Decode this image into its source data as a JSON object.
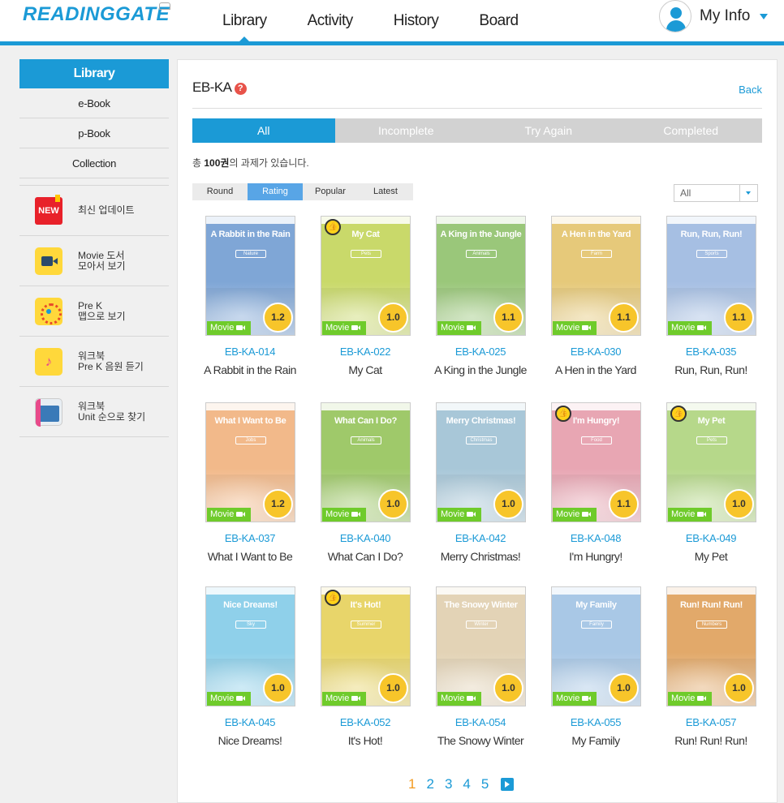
{
  "brand": {
    "logo_text": "READINGGATE"
  },
  "nav": {
    "items": [
      "Library",
      "Activity",
      "History",
      "Board"
    ],
    "active": "Library"
  },
  "user": {
    "label": "My Info"
  },
  "sidebar": {
    "title": "Library",
    "links": [
      "e-Book",
      "p-Book",
      "Collection"
    ],
    "features": [
      {
        "icon": "new-badge-icon",
        "badge": "NEW",
        "label": "최신 업데이트"
      },
      {
        "icon": "movie-camera-icon",
        "label": "Movie 도서\n모아서 보기"
      },
      {
        "icon": "pre-k-map-icon",
        "label": "Pre K\n맵으로 보기"
      },
      {
        "icon": "music-note-icon",
        "label": "워크북\nPre K 음원 듣기"
      },
      {
        "icon": "workbook-icon",
        "label": "워크북\nUnit 순으로 찾기"
      }
    ]
  },
  "main": {
    "title": "EB-KA",
    "help_symbol": "?",
    "back_label": "Back",
    "status_tabs": [
      "All",
      "Incomplete",
      "Try Again",
      "Completed"
    ],
    "count_prefix": "총 ",
    "count_value": "100권",
    "count_suffix": "의 과제가 있습니다.",
    "sort_tabs": [
      "Round",
      "Rating",
      "Popular",
      "Latest"
    ],
    "filter_value": "All",
    "movie_label": "Movie",
    "books": [
      {
        "code": "EB-KA-014",
        "title": "A Rabbit in the Rain",
        "cover_title": "A Rabbit in the Rain",
        "theme": "Nature",
        "level": "1.2",
        "recommended": false,
        "color": "#7fa6d6"
      },
      {
        "code": "EB-KA-022",
        "title": "My Cat",
        "cover_title": "My Cat",
        "theme": "Pets",
        "level": "1.0",
        "recommended": true,
        "color": "#c9d96a"
      },
      {
        "code": "EB-KA-025",
        "title": "A King in the Jungle",
        "cover_title": "A King in the Jungle",
        "theme": "Animals",
        "level": "1.1",
        "recommended": false,
        "color": "#9ac77a"
      },
      {
        "code": "EB-KA-030",
        "title": "A Hen in the Yard",
        "cover_title": "A Hen in the Yard",
        "theme": "Farm",
        "level": "1.1",
        "recommended": false,
        "color": "#e6c97a"
      },
      {
        "code": "EB-KA-035",
        "title": "Run, Run, Run!",
        "cover_title": "Run, Run, Run!",
        "theme": "Sports",
        "level": "1.1",
        "recommended": false,
        "color": "#a6bfe3"
      },
      {
        "code": "EB-KA-037",
        "title": "What I Want to Be",
        "cover_title": "What I Want to Be",
        "theme": "Jobs",
        "level": "1.2",
        "recommended": false,
        "color": "#f2b98a"
      },
      {
        "code": "EB-KA-040",
        "title": "What Can I Do?",
        "cover_title": "What Can I Do?",
        "theme": "Animals",
        "level": "1.0",
        "recommended": false,
        "color": "#9fc96a"
      },
      {
        "code": "EB-KA-042",
        "title": "Merry Christmas!",
        "cover_title": "Merry Christmas!",
        "theme": "Christmas",
        "level": "1.0",
        "recommended": false,
        "color": "#a8c7d8"
      },
      {
        "code": "EB-KA-048",
        "title": "I'm Hungry!",
        "cover_title": "I'm Hungry!",
        "theme": "Food",
        "level": "1.1",
        "recommended": true,
        "color": "#e8a6b3"
      },
      {
        "code": "EB-KA-049",
        "title": "My Pet",
        "cover_title": "My Pet",
        "theme": "Pets",
        "level": "1.0",
        "recommended": true,
        "color": "#b6d88a"
      },
      {
        "code": "EB-KA-045",
        "title": "Nice Dreams!",
        "cover_title": "Nice Dreams!",
        "theme": "Sky",
        "level": "1.0",
        "recommended": false,
        "color": "#8fd0ea"
      },
      {
        "code": "EB-KA-052",
        "title": "It's Hot!",
        "cover_title": "It's Hot!",
        "theme": "Summer",
        "level": "1.0",
        "recommended": true,
        "color": "#e8d56a"
      },
      {
        "code": "EB-KA-054",
        "title": "The Snowy Winter",
        "cover_title": "The Snowy Winter",
        "theme": "Winter",
        "level": "1.0",
        "recommended": false,
        "color": "#e3d3b6"
      },
      {
        "code": "EB-KA-055",
        "title": "My Family",
        "cover_title": "My Family",
        "theme": "Family",
        "level": "1.0",
        "recommended": false,
        "color": "#a9c8e6"
      },
      {
        "code": "EB-KA-057",
        "title": "Run! Run! Run!",
        "cover_title": "Run! Run! Run!",
        "theme": "Numbers",
        "level": "1.0",
        "recommended": false,
        "color": "#e2a96a"
      }
    ],
    "pagination": {
      "pages": [
        "1",
        "2",
        "3",
        "4",
        "5"
      ],
      "active": "1"
    }
  },
  "colors": {
    "accent": "#1b9ad6",
    "movie_badge": "#6fcb2b",
    "level_badge": "#f7c52a",
    "active_page": "#f39a1e"
  }
}
